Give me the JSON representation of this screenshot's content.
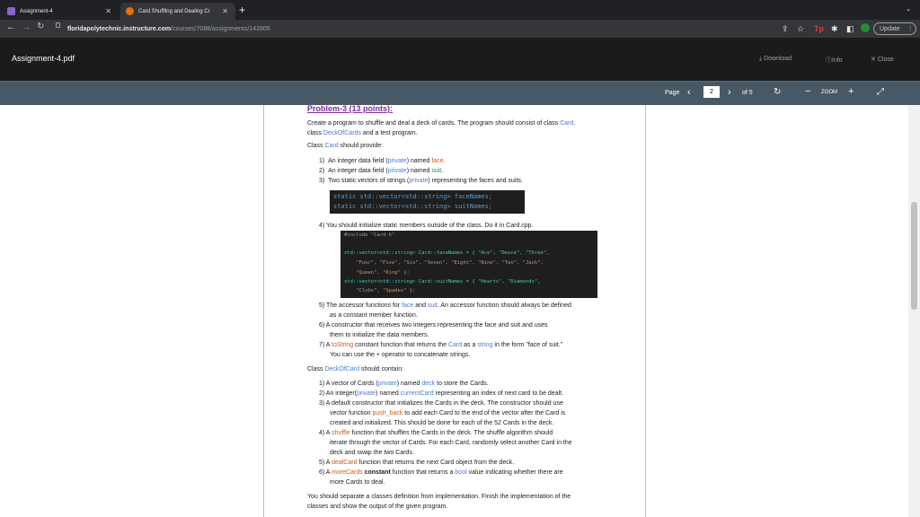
{
  "tabs": [
    {
      "label": "Assignment-4",
      "active": false,
      "color": "#8e63ce"
    },
    {
      "label": "Card Shuffling and Dealing Cr",
      "active": true,
      "color": "#e8710a"
    }
  ],
  "url": {
    "host": "floridapolytechnic.instructure.com",
    "path": "/courses/7088/assignments/142805"
  },
  "update_label": "Update",
  "file_title": "Assignment-4.pdf",
  "actions": {
    "download": "Download",
    "info": "Info",
    "close": "Close"
  },
  "pdf": {
    "page_label": "Page",
    "page": "2",
    "of": "of 5",
    "zoom": "ZOOM"
  },
  "doc": {
    "heading": "Problem-3 (13 points):",
    "intro1": "Create a program to shuffle and deal a deck of cards. The program should consist of class",
    "intro1b": "Card,",
    "intro2a": "class",
    "intro2b": "DeckOfCards",
    "intro2c": "and a test program.",
    "card_provide": "Class",
    "card_word": "Card",
    "provide_tail": "should provide:",
    "items": [
      {
        "n": "1)",
        "pre": "An integer data field (",
        "h": "private",
        "mid": ") named ",
        "h2": "face",
        "post": "."
      },
      {
        "n": "2)",
        "pre": "An integer data field (",
        "h": "private",
        "mid": ") named ",
        "h2": "suit",
        "post": "."
      },
      {
        "n": "3)",
        "pre": "Two static vectors of strings (",
        "h": "private",
        "mid": ") representing the faces and suits.",
        "h2": "",
        "post": ""
      }
    ],
    "code1": [
      "static std::vector<std::string> faceNames;",
      "static std::vector<std::string> suitNames;"
    ],
    "item4": "4)  You should initialize static members outside of the class. Do it in Card.cpp.",
    "code2": [
      "#include \"Card.h\"",
      "",
      "std::vector<std::string> Card::faceNames = { \"Ace\", \"Deuce\", \"Three\",",
      "    \"Four\", \"Five\", \"Six\", \"Seven\", \"Eight\", \"Nine\", \"Ten\", \"Jack\",",
      "    \"Queen\", \"King\" };",
      "std::vector<std::string> Card::suitNames = { \"Hearts\", \"Diamonds\",",
      "    \"Clubs\", \"Spades\" };"
    ],
    "item5a": "5)  The accessor functions for",
    "item5b": "face",
    "item5c": "and",
    "item5d": "suit",
    "item5e": ". An accessor function should always be defined",
    "item5f": "as a constant member function.",
    "item6a": "6)  A constructor that receives two integers representing the face and suit and uses",
    "item6b": "them to initialize the data members.",
    "item7a": "7)  A",
    "item7b": "toString",
    "item7c": "constant function that returns the",
    "item7d": "Card",
    "item7e": "as a",
    "item7f": "string",
    "item7g": "in the form \"face of suit.\"",
    "item7h": "You can use the + operator to concatenate strings.",
    "deck_a": "Class",
    "deck_b": "DeckOfCard",
    "deck_c": "should contain:",
    "d1a": "1)  A vector of Cards (",
    "d1b": "private",
    "d1c": ") named",
    "d1d": "deck",
    "d1e": "to store the Cards.",
    "d2a": "2)  An integer(",
    "d2b": "private",
    "d2c": ") named",
    "d2d": "currentCard",
    "d2e": "representing an index of next card to be dealt.",
    "d3a": "3)  A default constructor that initializes the Cards in the deck. The constructor should use",
    "d3b": "vector function",
    "d3c": "push_back",
    "d3d": "to add each Card to the end of the vector after the Card is",
    "d3e": "created and initialized. This should be done for each of the 52 Cards in the deck.",
    "d4a": "4)  A",
    "d4b": "shuffle",
    "d4c": "function that shuffles the Cards in the deck. The shuffle algorithm should",
    "d4d": "iterate through the vector of Cards. For each Card, randomly select another Card in the",
    "d4e": "deck and swap the two Cards.",
    "d5a": "5)  A",
    "d5b": "dealCard",
    "d5c": "function that returns the next Card object from the deck.",
    "d6a": "6)  A",
    "d6b": "moreCards",
    "d6c": "constant",
    "d6d": "function that returns a",
    "d6e": "bool",
    "d6f": "value indicating whether there are",
    "d6g": "more Cards to deal.",
    "final1": "You should separate a classes definition from implementation. Finish the implementation of the",
    "final2": "classes and show the output of the given program."
  }
}
